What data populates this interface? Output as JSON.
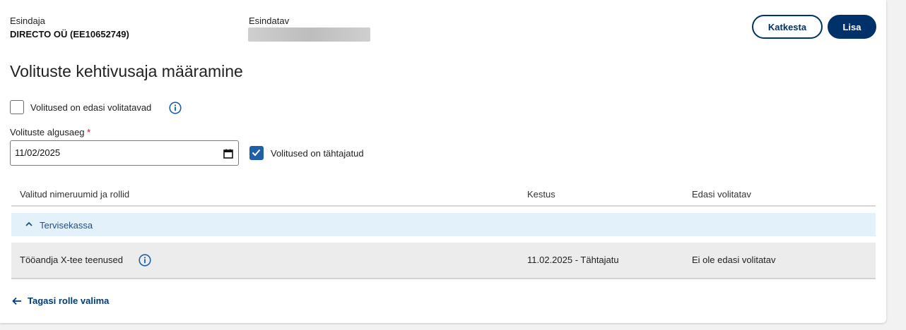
{
  "header": {
    "principal_label": "Esindaja",
    "principal_value": "DIRECTO OÜ (EE10652749)",
    "representative_label": "Esindatav",
    "cancel_label": "Katkesta",
    "add_label": "Lisa"
  },
  "page_title": "Volituste kehtivusaja määramine",
  "delegable_checkbox": {
    "label": "Volitused on edasi volitatavad",
    "checked": false
  },
  "start_date": {
    "label": "Volituste algusaeg",
    "required_marker": "*",
    "value": "11/02/2025"
  },
  "indefinite_checkbox": {
    "label": "Volitused on tähtajatud",
    "checked": true
  },
  "table": {
    "columns": [
      "Valitud nimeruumid ja rollid",
      "Kestus",
      "Edasi volitatav"
    ],
    "group": "Tervisekassa",
    "rows": [
      {
        "role": "Tööandja X-tee teenused",
        "duration": "11.02.2025 - Tähtajatu",
        "delegable": "Ei ole edasi volitatav"
      }
    ]
  },
  "back_link": "Tagasi rolle valima",
  "colors": {
    "primary": "#003168",
    "checkbox_checked": "#1f5fa8",
    "group_row_bg": "#e3f1fb",
    "data_row_bg": "#ececec",
    "required": "#c8102e"
  }
}
